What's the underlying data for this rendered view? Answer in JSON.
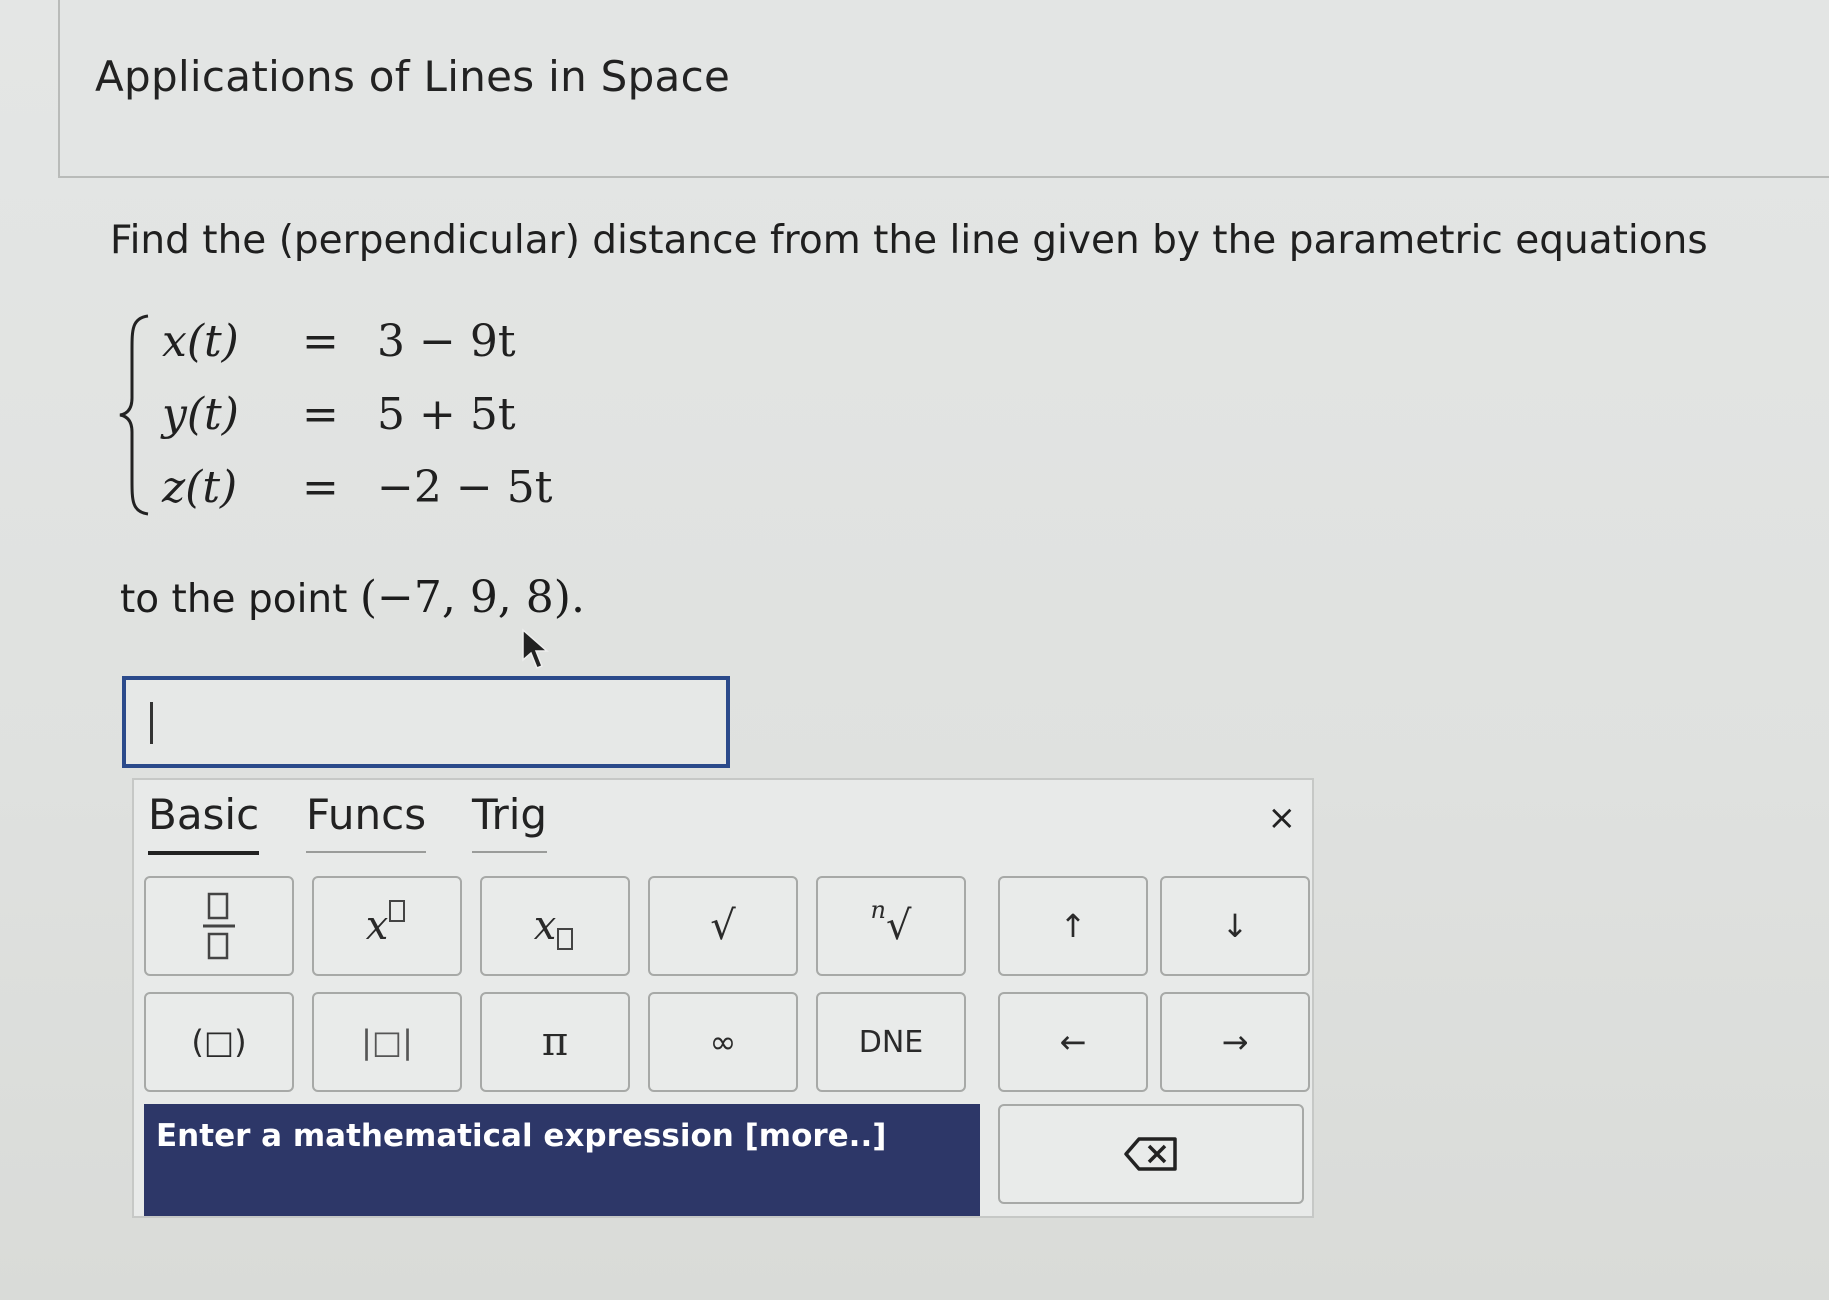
{
  "header": {
    "title": "Applications of Lines in Space"
  },
  "problem": {
    "prompt": "Find the (perpendicular) distance from the line given by the parametric equations",
    "equations": [
      {
        "lhs": "x(t)",
        "eq": "=",
        "rhs": "3 − 9t"
      },
      {
        "lhs": "y(t)",
        "eq": "=",
        "rhs": "5 + 5t"
      },
      {
        "lhs": "z(t)",
        "eq": "=",
        "rhs": "−2 − 5t"
      }
    ],
    "point_prefix": "to the point ",
    "point": "(−7, 9, 8)."
  },
  "answer": {
    "value": ""
  },
  "keypad": {
    "tabs": [
      {
        "label": "Basic",
        "active": true
      },
      {
        "label": "Funcs",
        "active": false
      },
      {
        "label": "Trig",
        "active": false
      }
    ],
    "close_label": "×",
    "keys": {
      "fraction_icon": "fraction-icon",
      "superscript_base": "x",
      "subscript_base": "x",
      "sqrt_label": "√",
      "nth_root_index": "n",
      "nth_root_label": "√",
      "up_arrow": "↑",
      "down_arrow": "↓",
      "parens_label": "(□)",
      "abs_label": "|□|",
      "pi_label": "π",
      "infinity_label": "∞",
      "dne_label": "DNE",
      "left_arrow": "←",
      "right_arrow": "→"
    },
    "help_text": "Enter a mathematical expression [more..]",
    "backspace_icon": "backspace-icon"
  },
  "colors": {
    "input_border": "#2b4a8b",
    "help_bar_bg": "#2d3768"
  }
}
